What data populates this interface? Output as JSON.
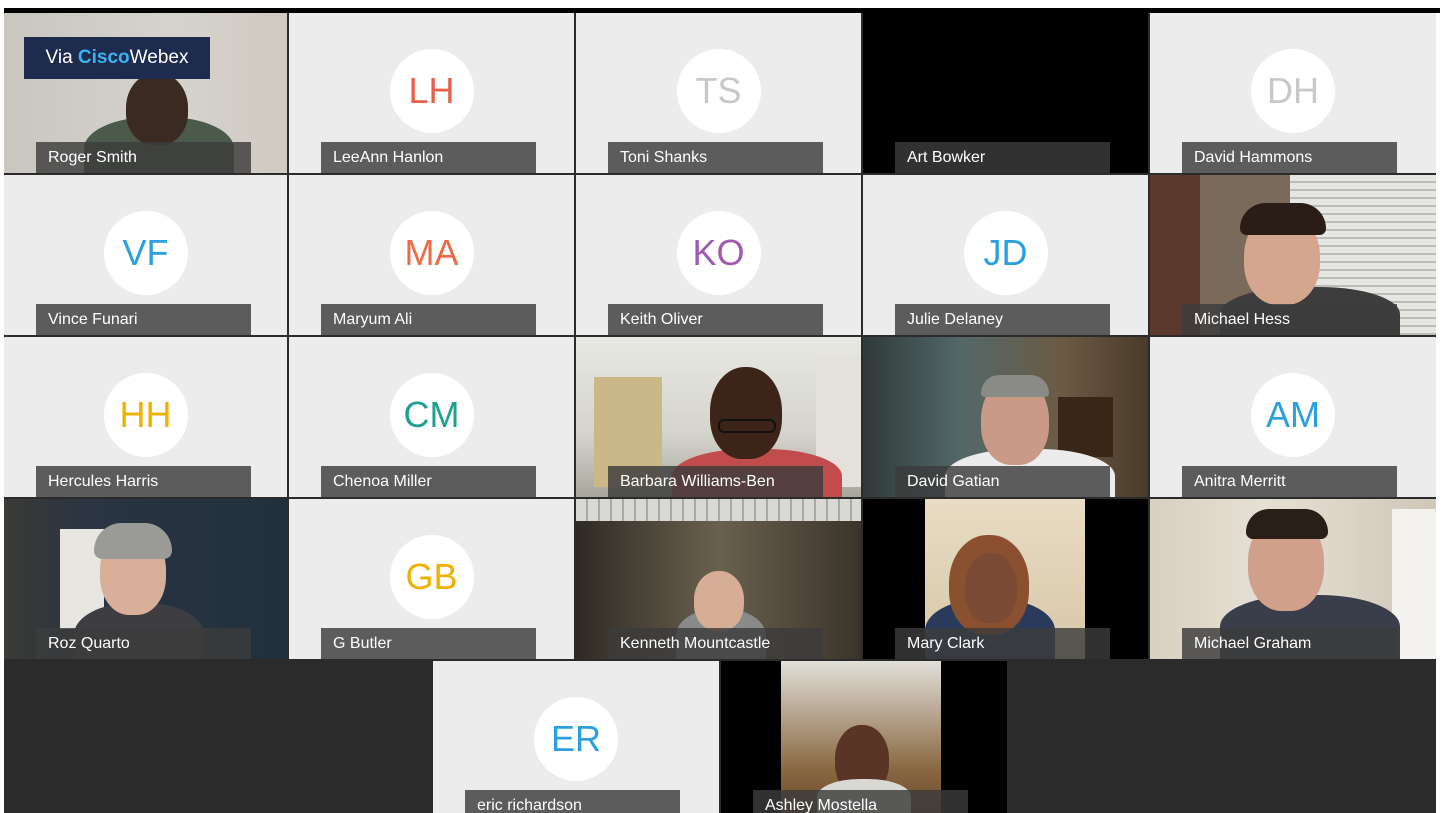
{
  "badge": {
    "via": "Via",
    "cisco": "Cisco",
    "webex": "Webex"
  },
  "participants": [
    {
      "name": "Roger Smith",
      "initials": "",
      "type": "video"
    },
    {
      "name": "LeeAnn Hanlon",
      "initials": "LH",
      "color": "#e8604a"
    },
    {
      "name": "Toni Shanks",
      "initials": "TS",
      "color": "#c8c8c8"
    },
    {
      "name": "Art Bowker",
      "initials": "",
      "type": "blank"
    },
    {
      "name": "David Hammons",
      "initials": "DH",
      "color": "#c8c8c8"
    },
    {
      "name": "Vince Funari",
      "initials": "VF",
      "color": "#2aa0e0"
    },
    {
      "name": "Maryum Ali",
      "initials": "MA",
      "color": "#ee6a45"
    },
    {
      "name": "Keith Oliver",
      "initials": "KO",
      "color": "#a05ab0"
    },
    {
      "name": "Julie Delaney",
      "initials": "JD",
      "color": "#2aa0e0"
    },
    {
      "name": "Michael Hess",
      "initials": "",
      "type": "video"
    },
    {
      "name": "Hercules Harris",
      "initials": "HH",
      "color": "#f0b000"
    },
    {
      "name": "Chenoa Miller",
      "initials": "CM",
      "color": "#20a090"
    },
    {
      "name": "Barbara Williams-Ben",
      "initials": "",
      "type": "video"
    },
    {
      "name": "David Gatian",
      "initials": "",
      "type": "video"
    },
    {
      "name": "Anitra Merritt",
      "initials": "AM",
      "color": "#2aa0e0"
    },
    {
      "name": "Roz Quarto",
      "initials": "",
      "type": "video"
    },
    {
      "name": "G Butler",
      "initials": "GB",
      "color": "#f0b000"
    },
    {
      "name": "Kenneth Mountcastle",
      "initials": "",
      "type": "video"
    },
    {
      "name": "Mary Clark",
      "initials": "",
      "type": "video"
    },
    {
      "name": "Michael Graham",
      "initials": "",
      "type": "video"
    },
    {
      "name": "eric richardson",
      "initials": "ER",
      "color": "#2aa0e0"
    },
    {
      "name": "Ashley Mostella",
      "initials": "",
      "type": "video"
    }
  ]
}
